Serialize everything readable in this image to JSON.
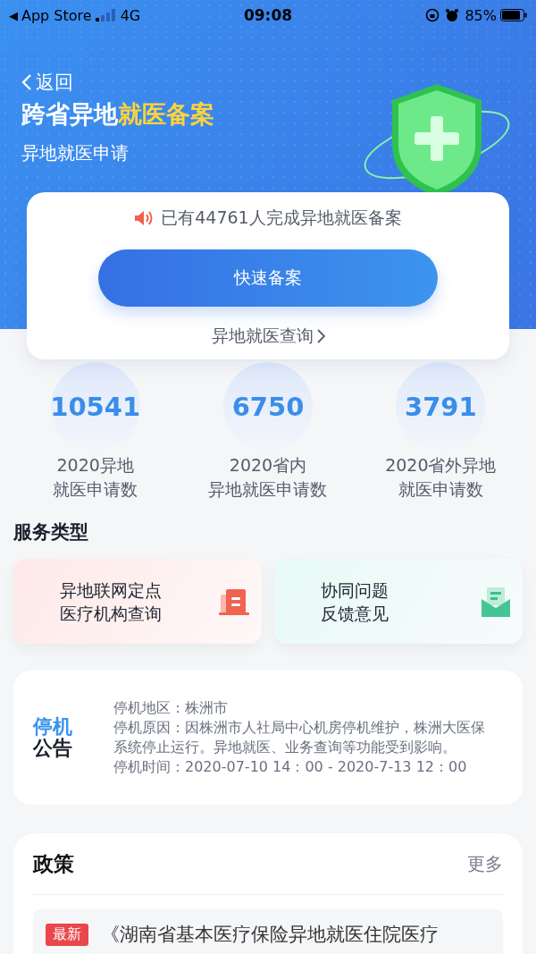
{
  "status_bar": {
    "back_glyph": "◀",
    "back_app": "App Store",
    "network": "4G",
    "time": "09:08",
    "battery": "85%"
  },
  "header": {
    "back": "返回",
    "title": [
      {
        "text": "跨省异地",
        "highlight": false
      },
      {
        "text": "就医备案",
        "highlight": true
      }
    ],
    "subtitle": "异地就医申请"
  },
  "main_card": {
    "notice": "已有44761人完成异地就医备案",
    "button": "快速备案",
    "link": "异地就医查询"
  },
  "stats": [
    {
      "value": "10541",
      "label": [
        "2020异地",
        "就医申请数"
      ]
    },
    {
      "value": "6750",
      "label": [
        "2020省内",
        "异地就医申请数"
      ]
    },
    {
      "value": "3791",
      "label": [
        "2020省外异地",
        "就医申请数"
      ]
    }
  ],
  "services": {
    "title": "服务类型",
    "items": [
      {
        "kind": "institution",
        "label": [
          "异地联网定点",
          "医疗机构查询"
        ]
      },
      {
        "kind": "feedback",
        "label": [
          "协同问题",
          "反馈意见"
        ]
      }
    ]
  },
  "announcement": {
    "title": [
      {
        "text": "停机",
        "highlight": true
      },
      {
        "text": "公告",
        "highlight": false
      }
    ],
    "lines": [
      "停机地区：株洲市",
      "停机原因：因株洲市人社局中心机房停机维护，株洲大医保系统停止运行。异地就医、业务查询等功能受到影响。",
      "停机时间：2020-07-10 14：00 - 2020-7-13 12：00"
    ]
  },
  "policy": {
    "title": "政策",
    "more": "更多",
    "items": [
      {
        "tag": "最新",
        "text": "《湖南省基本医疗保险异地就医住院医疗"
      }
    ]
  }
}
